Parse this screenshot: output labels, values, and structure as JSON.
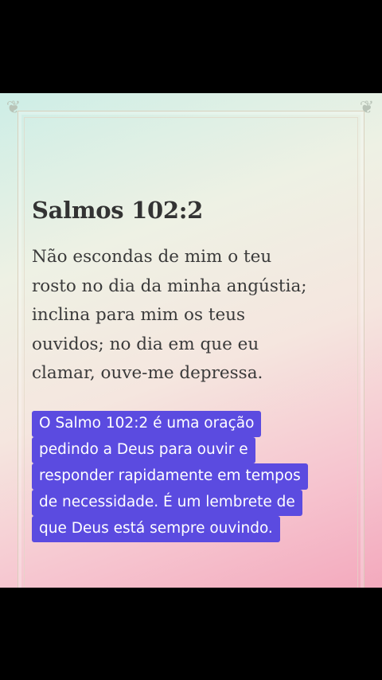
{
  "card": {
    "title": "Salmos 102:2",
    "verse_lines": [
      "Não escondas de mim o teu",
      "rosto no dia da minha angústia;",
      "inclina para mim os teus",
      "ouvidos; no dia em que eu",
      "clamar, ouve-me depressa."
    ]
  },
  "caption": {
    "lines": [
      "O Salmo 102:2 é uma oração",
      "pedindo a Deus para ouvir e",
      "responder rapidamente em tempos",
      "de necessidade. É um lembrete de",
      "que Deus está sempre ouvindo."
    ],
    "background_color": "#5b4be0"
  },
  "icons": {
    "corner_left": "ornament-corner-left-icon",
    "corner_right": "ornament-corner-right-icon"
  }
}
